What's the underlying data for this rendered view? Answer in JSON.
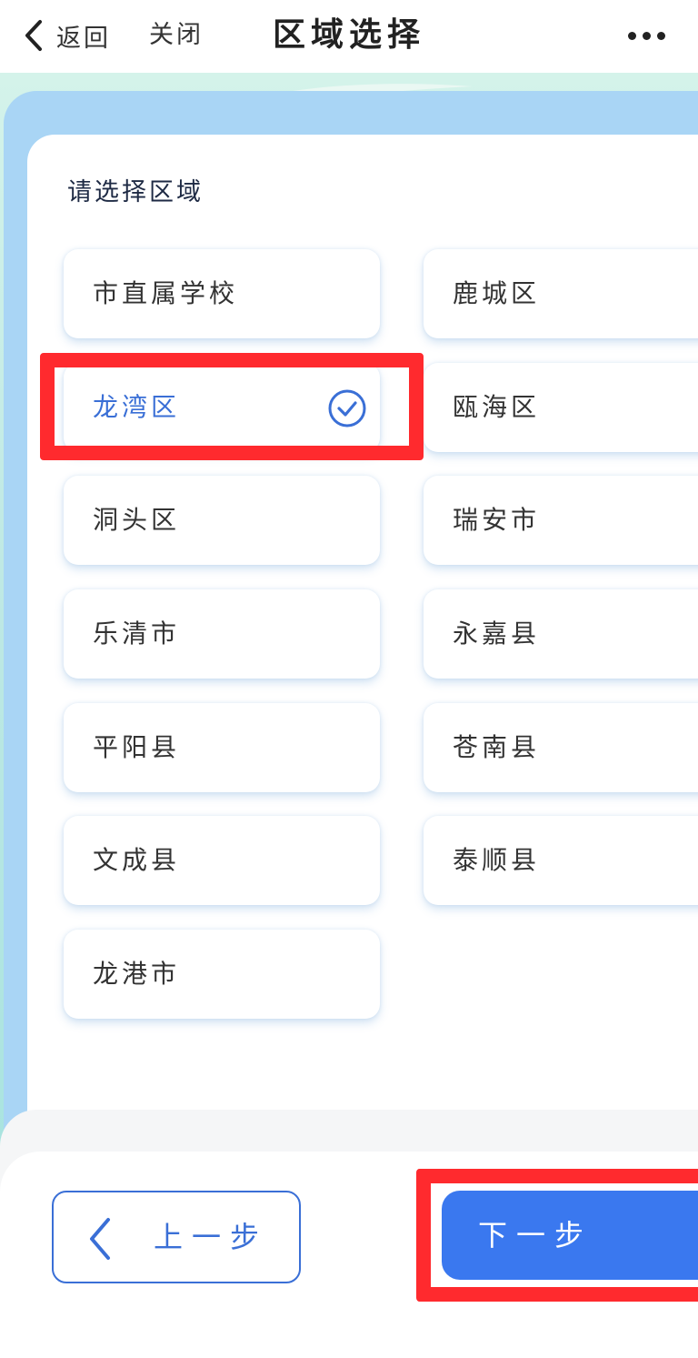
{
  "nav": {
    "back_label": "返回",
    "close_label": "关闭",
    "title": "区域选择"
  },
  "section_title": "请选择区域",
  "selected_region": "龙湾区",
  "regions": [
    {
      "label": "市直属学校"
    },
    {
      "label": "鹿城区"
    },
    {
      "label": "龙湾区"
    },
    {
      "label": "瓯海区"
    },
    {
      "label": "洞头区"
    },
    {
      "label": "瑞安市"
    },
    {
      "label": "乐清市"
    },
    {
      "label": "永嘉县"
    },
    {
      "label": "平阳县"
    },
    {
      "label": "苍南县"
    },
    {
      "label": "文成县"
    },
    {
      "label": "泰顺县"
    },
    {
      "label": "龙港市"
    }
  ],
  "footer": {
    "prev_label": "上一步",
    "next_label": "下一步"
  },
  "colors": {
    "accent": "#3a6fd6",
    "primary_button": "#3a78ef",
    "highlight_border": "#ff2a2e",
    "panel_blue": "#a9d5f5"
  },
  "icons": {
    "back": "chevron-left-icon",
    "more": "more-dots-icon",
    "selected": "check-circle-icon",
    "prev": "chevron-left-icon"
  }
}
